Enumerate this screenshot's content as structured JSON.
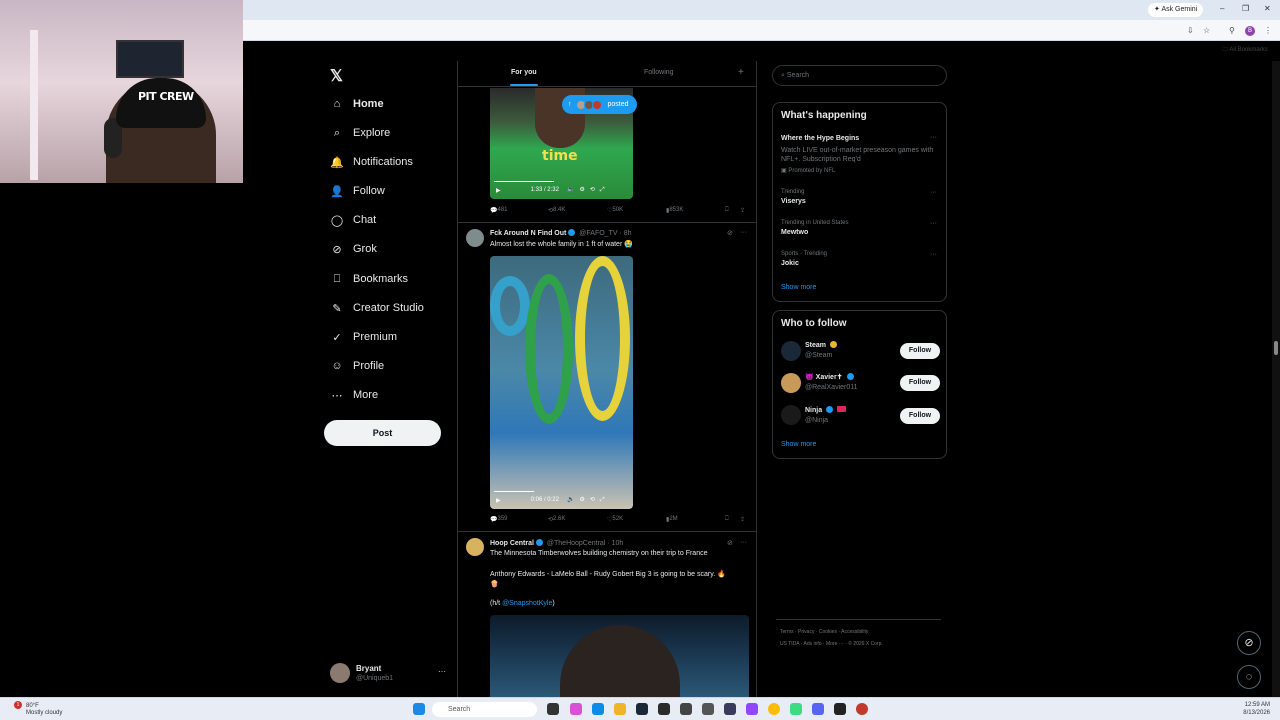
{
  "browser": {
    "ask_gemini": "Ask Gemini",
    "all_bookmarks": "All Bookmarks",
    "profile_initial": "B"
  },
  "webcam": {
    "hat_text": "PIT CREW"
  },
  "nav": {
    "items": [
      {
        "label": "Home",
        "icon": "home-icon",
        "glyph": "⌂"
      },
      {
        "label": "Explore",
        "icon": "search-icon",
        "glyph": "⌕"
      },
      {
        "label": "Notifications",
        "icon": "bell-icon",
        "glyph": "🔔"
      },
      {
        "label": "Follow",
        "icon": "follow-icon",
        "glyph": "👤"
      },
      {
        "label": "Chat",
        "icon": "chat-icon",
        "glyph": "◯"
      },
      {
        "label": "Grok",
        "icon": "grok-icon",
        "glyph": "⊘"
      },
      {
        "label": "Bookmarks",
        "icon": "bookmark-icon",
        "glyph": "⎕"
      },
      {
        "label": "Creator Studio",
        "icon": "creator-studio-icon",
        "glyph": "✎"
      },
      {
        "label": "Premium",
        "icon": "premium-icon",
        "glyph": "✓"
      },
      {
        "label": "Profile",
        "icon": "profile-icon",
        "glyph": "☺"
      },
      {
        "label": "More",
        "icon": "more-icon",
        "glyph": "⋯"
      }
    ],
    "post_label": "Post",
    "account": {
      "name": "Bryant",
      "handle": "@Uniqueb1"
    }
  },
  "feed": {
    "tabs": [
      "For you",
      "Following"
    ],
    "posted_pill": "posted",
    "video1": {
      "caption": "time",
      "time": "1:33 / 2:32"
    },
    "tweet1_actions": {
      "replies": "481",
      "reposts": "8.4K",
      "likes": "50K",
      "views": "853K"
    },
    "tweet2": {
      "name": "Fck Around N Find Out",
      "handle": "@FAFO_TV",
      "age": "· 8h",
      "text": "Almost lost the whole family in 1 ft of water 😭",
      "video_time": "0:06 / 0:22",
      "replies": "359",
      "reposts": "2.6K",
      "likes": "52K",
      "views": "2M"
    },
    "tweet3": {
      "name": "Hoop Central",
      "handle": "@TheHoopCentral",
      "age": "· 10h",
      "line1": "The Minnesota Timberwolves building chemistry on their trip to France",
      "line2": "Anthony Edwards - LaMelo Ball - Rudy Gobert Big 3 is going to be scary. 🔥",
      "line3": "🍿",
      "line4_prefix": "(h/t ",
      "line4_link": "@SnapshotKyle",
      "line4_suffix": ")"
    }
  },
  "right": {
    "search_placeholder": "Search",
    "whats_happening": {
      "title": "What's happening",
      "promo": {
        "name": "Where the Hype Begins",
        "desc": "Watch LIVE out-of-market preseason games with NFL+. Subscription Req'd",
        "promoted": "Promoted by NFL"
      },
      "trends": [
        {
          "ctx": "Trending",
          "name": "Viserys"
        },
        {
          "ctx": "Trending in United States",
          "name": "Mewtwo"
        },
        {
          "ctx": "Sports · Trending",
          "name": "Jokic"
        }
      ],
      "show_more": "Show more"
    },
    "who_to_follow": {
      "title": "Who to follow",
      "accounts": [
        {
          "name": "Steam",
          "handle": "@Steam",
          "button": "Follow"
        },
        {
          "name": "😈 Xavier✝",
          "handle": "@RealXavier011",
          "button": "Follow"
        },
        {
          "name": "Ninja",
          "handle": "@Ninja",
          "button": "Follow"
        }
      ],
      "show_more": "Show more"
    },
    "footer1": "Terms  ·  Privacy  ·  Cookies  ·  Accessibility",
    "footer2": "US TIDA  ·  Ads info  ·  More ···  ·  © 2026 X Corp."
  },
  "taskbar": {
    "weather_temp": "80°F",
    "weather_desc": "Mostly cloudy",
    "notif_count": "1",
    "search": "Search",
    "time": "12:59 AM",
    "date": "8/13/2026"
  },
  "colors": {
    "accent": "#1d9bf0",
    "background": "#000000",
    "border": "#2f3336"
  }
}
